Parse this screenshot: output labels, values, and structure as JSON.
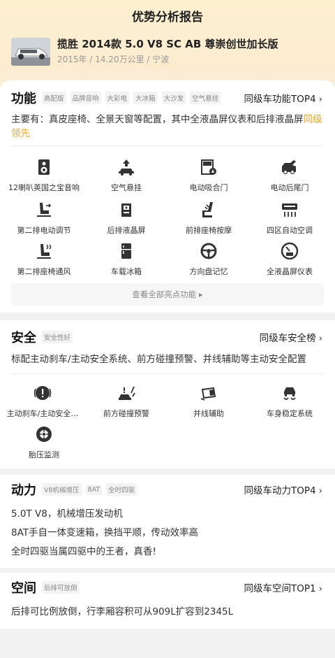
{
  "page": {
    "title": "优势分析报告"
  },
  "car": {
    "name": "揽胜 2014款 5.0 V8 SC AB 尊崇创世加长版",
    "meta": "2015年 / 14.20万公里 / 宁波"
  },
  "function": {
    "title": "功能",
    "tags": [
      "高配版",
      "品牌音响",
      "大彩电",
      "大冰箱",
      "大沙发",
      "空气悬挂"
    ],
    "rank_link": "同级车功能TOP4",
    "desc_main": "主要有：真皮座椅、全景天窗等配置，其中全液晶屏仪表和后排液晶屏",
    "desc_highlight": "同级领先",
    "features": [
      {
        "label": "12喇叭英国之宝音响",
        "icon": "speaker-icon"
      },
      {
        "label": "空气悬挂",
        "icon": "air-suspension-icon"
      },
      {
        "label": "电动吸合门",
        "icon": "soft-close-door-icon"
      },
      {
        "label": "电动后尾门",
        "icon": "power-tailgate-icon"
      },
      {
        "label": "第二排电动调节",
        "icon": "second-row-seat-adjust-icon"
      },
      {
        "label": "后排液晶屏",
        "icon": "rear-screen-icon"
      },
      {
        "label": "前排座椅按摩",
        "icon": "seat-massage-icon"
      },
      {
        "label": "四区自动空调",
        "icon": "climate-control-icon"
      },
      {
        "label": "第二排座椅通风",
        "icon": "seat-ventilation-icon"
      },
      {
        "label": "车载冰箱",
        "icon": "fridge-icon"
      },
      {
        "label": "方向盘记忆",
        "icon": "steering-wheel-memory-icon"
      },
      {
        "label": "全液晶屏仪表",
        "icon": "lcd-cluster-icon"
      }
    ],
    "more_label": "查看全部亮点功能 ▸"
  },
  "safety": {
    "title": "安全",
    "tags": [
      "安全性好"
    ],
    "rank_link": "同级车安全榜",
    "desc": "标配主动刹车/主动安全系统、前方碰撞预警、并线辅助等主动安全配置",
    "features": [
      {
        "label": "主动刹车/主动安全…",
        "icon": "active-brake-icon"
      },
      {
        "label": "前方碰撞预警",
        "icon": "collision-warning-icon"
      },
      {
        "label": "并线辅助",
        "icon": "blind-spot-icon"
      },
      {
        "label": "车身稳定系统",
        "icon": "stability-control-icon"
      },
      {
        "label": "胎压监测",
        "icon": "tire-pressure-icon"
      }
    ]
  },
  "power": {
    "title": "动力",
    "tags": [
      "V8机械增压",
      "8AT",
      "全时四驱"
    ],
    "rank_link": "同级车动力TOP4",
    "lines": [
      "5.0T V8，机械增压发动机",
      "8AT手自一体变速箱，换挡平顺，传动效率高",
      "全时四驱当属四驱中的王者，真香!"
    ]
  },
  "space": {
    "title": "空间",
    "tags": [
      "后排可放倒"
    ],
    "rank_link": "同级车空间TOP1",
    "desc": "后排可比例放倒，行李厢容积可从909L扩容到2345L"
  },
  "colors": {
    "highlight": "#e3a92a",
    "icon": "#333333"
  }
}
